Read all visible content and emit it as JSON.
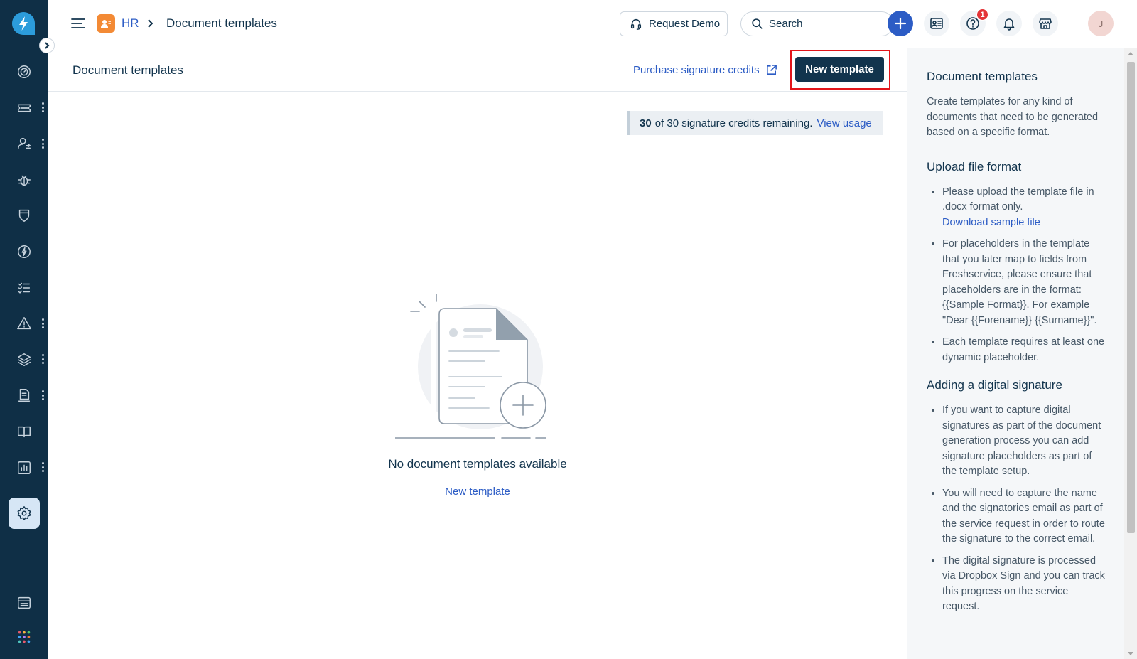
{
  "header": {
    "breadcrumb_module": "HR",
    "breadcrumb_current": "Document templates",
    "request_demo_label": "Request Demo",
    "search_label": "Search",
    "help_badge_count": "1",
    "avatar_initial": "J"
  },
  "page": {
    "title": "Document templates",
    "purchase_link": "Purchase signature credits",
    "new_template_button": "New template"
  },
  "credits": {
    "remaining": "30",
    "text": "of 30 signature credits remaining.",
    "view_usage": "View usage"
  },
  "empty_state": {
    "message": "No document templates available",
    "action_link": "New template"
  },
  "help_panel": {
    "title": "Document templates",
    "intro": "Create templates for any kind of documents that need to be generated based on a specific format.",
    "upload_title": "Upload file format",
    "upload_items": [
      "Please upload the template file in .docx format only.",
      "For placeholders in the template that you later map to fields from Freshservice, please ensure that placeholders are in the format: {{Sample Format}}. For example \"Dear {{Forename}} {{Surname}}\".",
      "Each template requires at least one dynamic placeholder."
    ],
    "download_sample": "Download sample file",
    "signature_title": "Adding a digital signature",
    "signature_items": [
      "If you want to capture digital signatures as part of the document generation process you can add signature placeholders as part of the template setup.",
      "You will need to capture the name and the signatories email as part of the service request in order to route the signature to the correct email.",
      "The digital signature is processed via Dropbox Sign and you can track this progress on the service request."
    ]
  },
  "sidebar": {
    "icons": [
      "dashboard-icon",
      "tickets-icon",
      "people-icon",
      "bug-icon",
      "shield-icon",
      "bolt-icon",
      "tasks-icon",
      "alert-icon",
      "layers-icon",
      "docs-icon",
      "book-icon",
      "reports-icon",
      "settings-icon",
      "catalog-icon",
      "apps-icon"
    ]
  },
  "colors": {
    "sidebar_bg": "#0f2f46",
    "primary": "#12344d",
    "link": "#2c5cc5",
    "hr_badge": "#f38a35",
    "highlight": "#e3151a",
    "notification": "#e43538"
  }
}
